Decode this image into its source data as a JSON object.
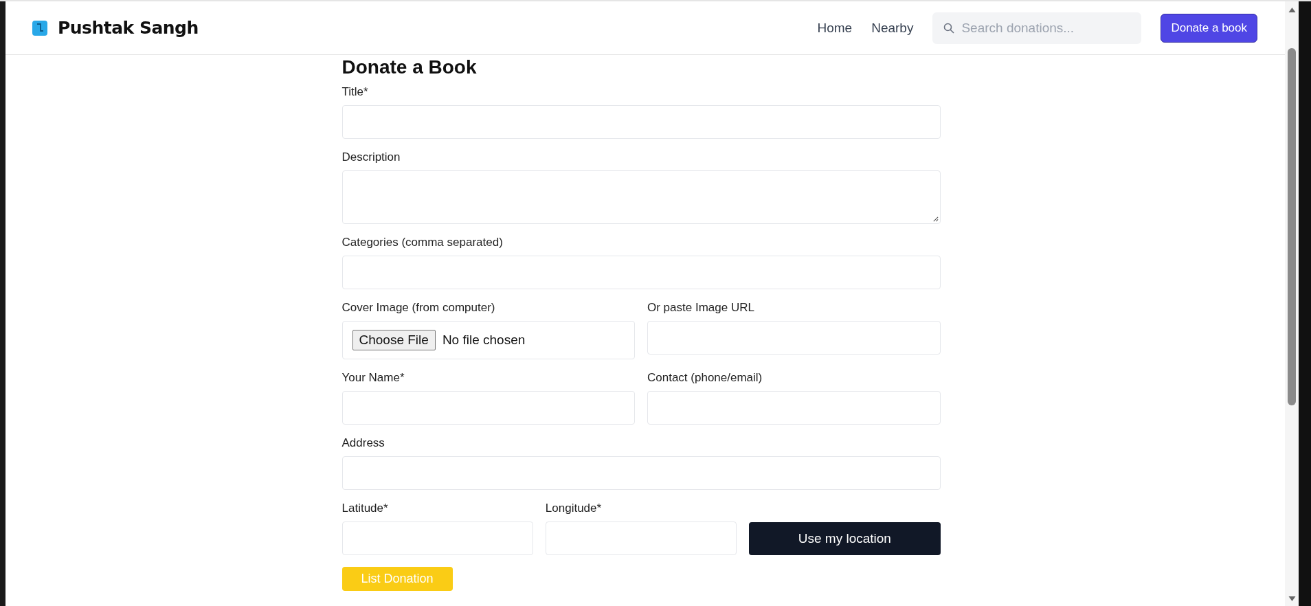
{
  "header": {
    "brand": "Pushtak Sangh",
    "nav": [
      {
        "label": "Home"
      },
      {
        "label": "Nearby"
      }
    ],
    "search": {
      "placeholder": "Search donations..."
    },
    "donate_button": "Donate a book"
  },
  "form": {
    "title": "Donate a Book",
    "rows": [
      [
        {
          "kind": "text",
          "label": "Title*"
        }
      ],
      [
        {
          "kind": "textarea",
          "label": "Description"
        }
      ],
      [
        {
          "kind": "text",
          "label": "Categories (comma separated)"
        }
      ],
      [
        {
          "kind": "file",
          "label": "Cover Image (from computer)",
          "button": "Choose File",
          "status": "No file chosen"
        },
        {
          "kind": "text",
          "label": "Or paste Image URL"
        }
      ],
      [
        {
          "kind": "text",
          "label": "Your Name*"
        },
        {
          "kind": "text",
          "label": "Contact (phone/email)"
        }
      ],
      [
        {
          "kind": "text",
          "label": "Address"
        }
      ],
      [
        {
          "kind": "text",
          "label": "Latitude*"
        },
        {
          "kind": "text",
          "label": "Longitude*"
        },
        {
          "kind": "button",
          "label": "Use my location"
        }
      ]
    ],
    "submit": "List Donation"
  }
}
